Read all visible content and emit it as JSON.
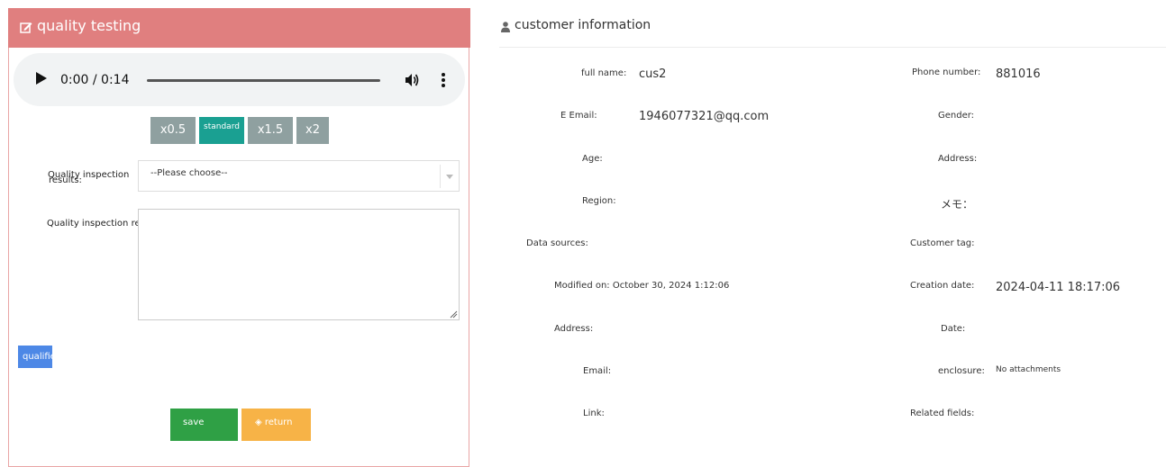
{
  "quality_panel": {
    "title": "quality testing",
    "title_icon": "edit-icon",
    "audio": {
      "time": "0:00 / 0:14",
      "progress": 0
    },
    "speed_buttons": [
      "x0.5",
      "standard",
      "x1.5",
      "x2"
    ],
    "active_speed": "standard",
    "results_label_line1": "Quality inspection",
    "results_label_line2": "results:",
    "results_select": {
      "value": "--Please choose--"
    },
    "remarks_label": "Quality inspection remarks:",
    "remarks_value": "",
    "qualified_label": "qualified",
    "save_label": "save",
    "return_label": "◈ return"
  },
  "customer_info": {
    "title": "customer information",
    "title_icon": "user-icon",
    "fields": {
      "full_name": {
        "label": "full name:",
        "value": "cus2"
      },
      "phone": {
        "label": "Phone number:",
        "value": "881016"
      },
      "email_e": {
        "label": "E Email:",
        "value": "1946077321@qq.com"
      },
      "gender": {
        "label": "Gender:",
        "value": ""
      },
      "age": {
        "label": "Age:",
        "value": ""
      },
      "address1": {
        "label": "Address:",
        "value": ""
      },
      "region": {
        "label": "Region:",
        "value": ""
      },
      "memo": {
        "label": "メモ：",
        "value": ""
      },
      "data_sources": {
        "label": "Data sources:",
        "value": ""
      },
      "customer_tag": {
        "label": "Customer tag:",
        "value": ""
      },
      "modified_on": {
        "label": "Modified on: October 30, 2024 1:12:06"
      },
      "creation_date": {
        "label": "Creation date:",
        "value": "2024-04-11 18:17:06"
      },
      "address2": {
        "label": "Address:",
        "value": ""
      },
      "date": {
        "label": "Date:",
        "value": ""
      },
      "email": {
        "label": "Email:",
        "value": ""
      },
      "enclosure": {
        "label": "enclosure:",
        "value": "No attachments"
      },
      "link": {
        "label": "Link:",
        "value": ""
      },
      "related_fields": {
        "label": "Related fields:",
        "value": ""
      }
    }
  }
}
